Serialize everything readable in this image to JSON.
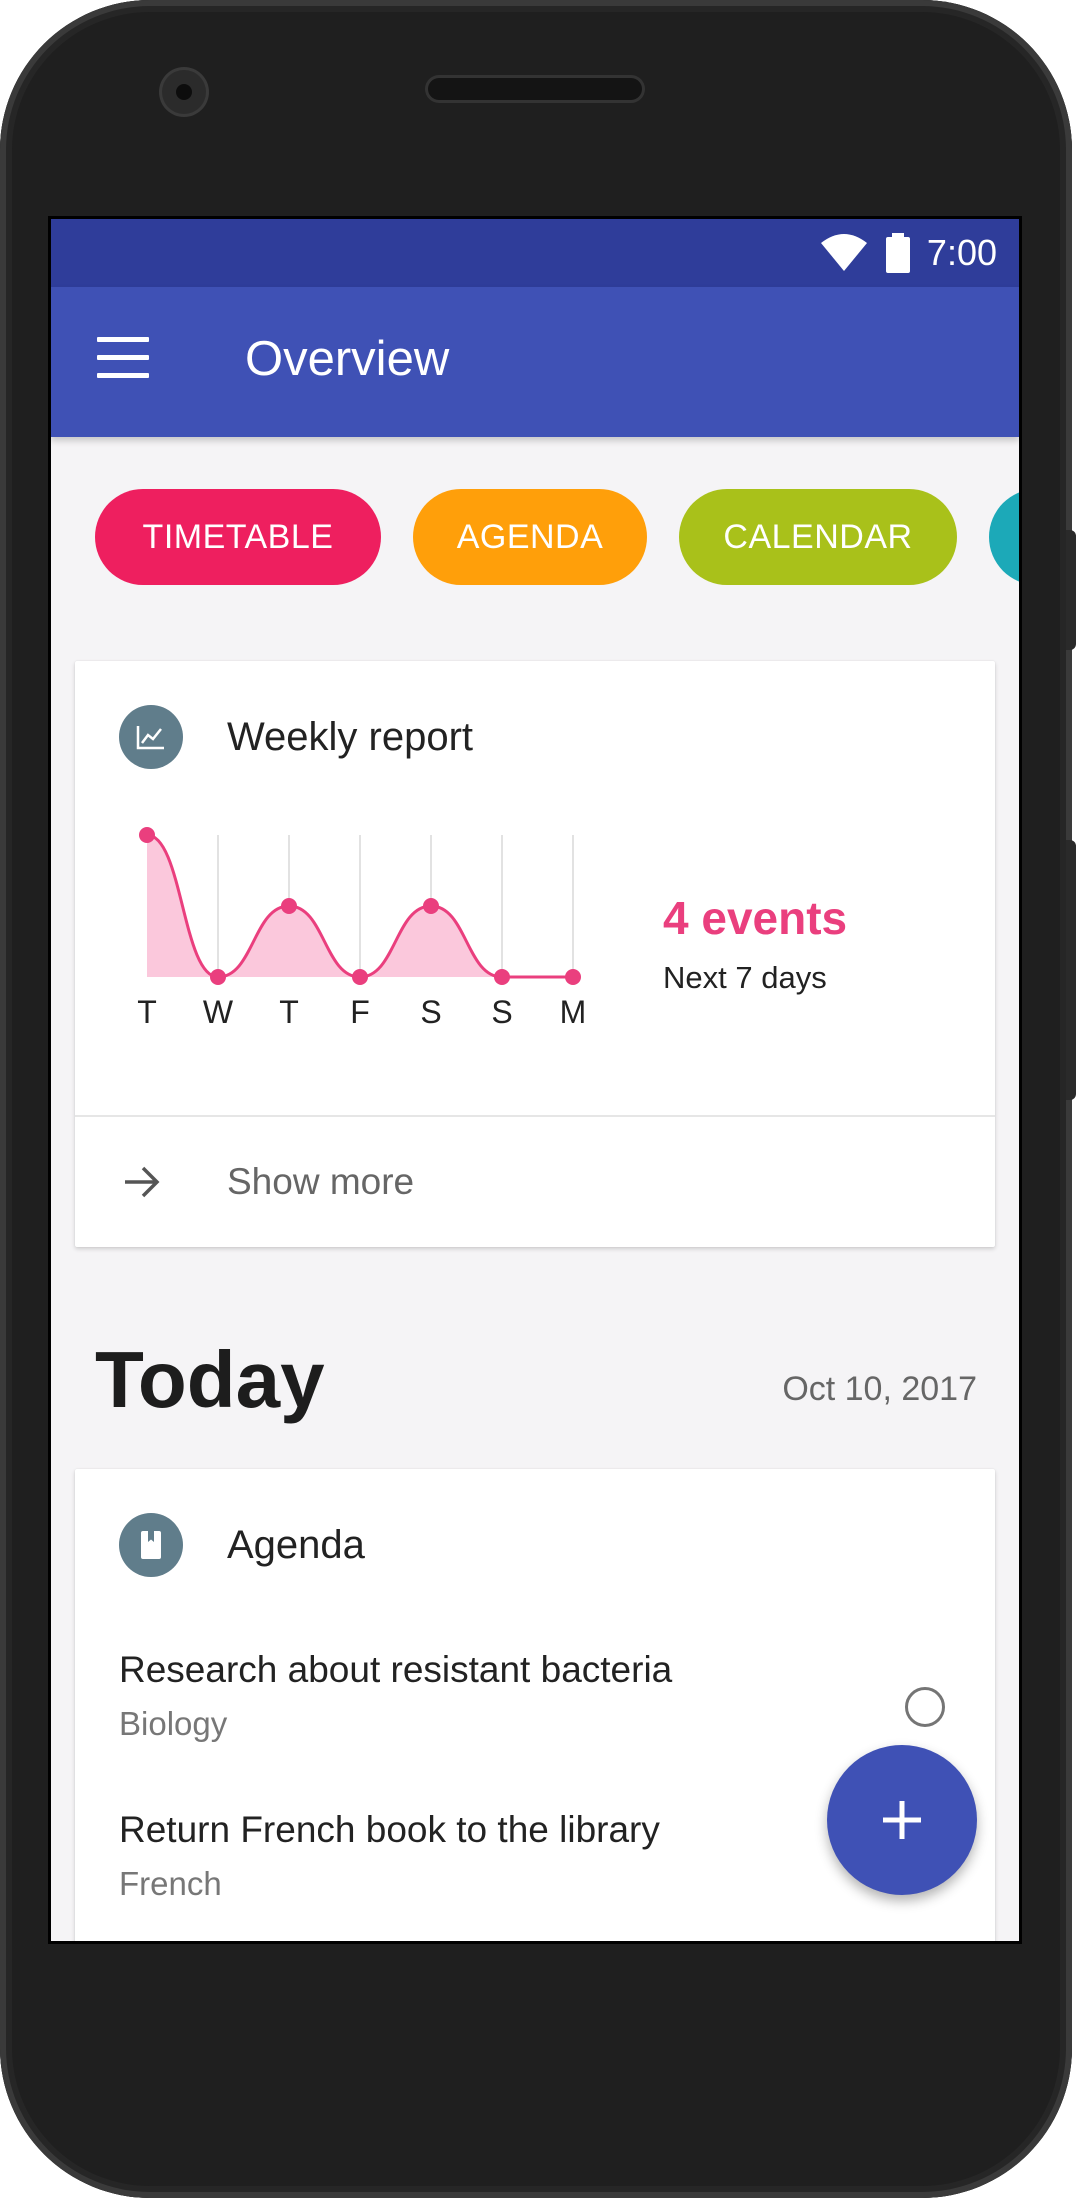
{
  "status_bar": {
    "time": "7:00"
  },
  "app_bar": {
    "title": "Overview"
  },
  "chips": [
    {
      "label": "TIMETABLE",
      "color": "#ee1f5f"
    },
    {
      "label": "AGENDA",
      "color": "#ff9f0a"
    },
    {
      "label": "CALENDAR",
      "color": "#a9c11a"
    },
    {
      "label": "",
      "color": "#1ca9b8"
    }
  ],
  "weekly_report": {
    "title": "Weekly report",
    "events_count": "4 events",
    "events_period": "Next 7 days",
    "show_more_label": "Show more"
  },
  "chart_data": {
    "type": "area",
    "categories": [
      "T",
      "W",
      "T",
      "F",
      "S",
      "S",
      "M"
    ],
    "values": [
      2,
      0,
      1,
      0,
      1,
      0,
      0
    ],
    "ylim": [
      0,
      2
    ],
    "grid": "vertical",
    "color": "#ea3f7e",
    "fill_color": "#fbc8dc"
  },
  "today": {
    "title": "Today",
    "date": "Oct 10, 2017"
  },
  "agenda": {
    "title": "Agenda",
    "items": [
      {
        "title": "Research about resistant bacteria",
        "subject": "Biology"
      },
      {
        "title": "Return French book to the library",
        "subject": "French"
      }
    ]
  },
  "fab": {
    "icon": "plus-icon"
  },
  "colors": {
    "primary": "#3f51b5",
    "primary_dark": "#2f3d9a",
    "accent": "#ea3f7e",
    "card_icon": "#607d8b"
  }
}
